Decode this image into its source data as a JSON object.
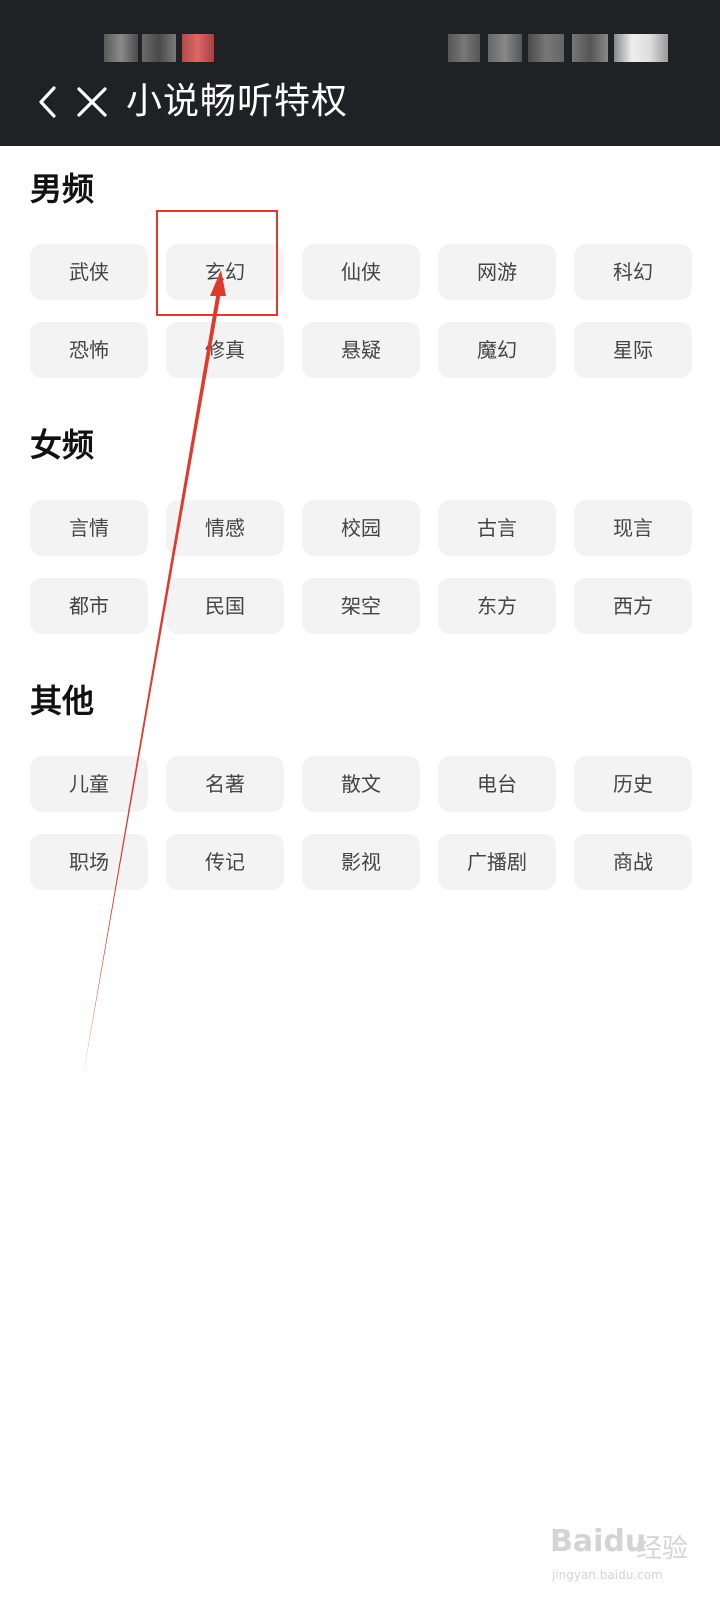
{
  "header": {
    "title": "小说畅听特权",
    "back_icon": "chevron-left-icon",
    "close_icon": "close-icon"
  },
  "sections": [
    {
      "title": "男频",
      "items": [
        "武侠",
        "玄幻",
        "仙侠",
        "网游",
        "科幻",
        "恐怖",
        "修真",
        "悬疑",
        "魔幻",
        "星际"
      ]
    },
    {
      "title": "女频",
      "items": [
        "言情",
        "情感",
        "校园",
        "古言",
        "现言",
        "都市",
        "民国",
        "架空",
        "东方",
        "西方"
      ]
    },
    {
      "title": "其他",
      "items": [
        "儿童",
        "名著",
        "散文",
        "电台",
        "历史",
        "职场",
        "传记",
        "影视",
        "广播剧",
        "商战"
      ]
    }
  ],
  "annotation": {
    "highlighted_item": "玄幻",
    "color": "#e03a2f"
  },
  "watermark": {
    "logo": "Baidu",
    "cn": "经验",
    "url": "jingyan.baidu.com"
  },
  "colors": {
    "header_bg": "#202124",
    "chip_bg": "#f3f3f3",
    "chip_text": "#444444"
  }
}
